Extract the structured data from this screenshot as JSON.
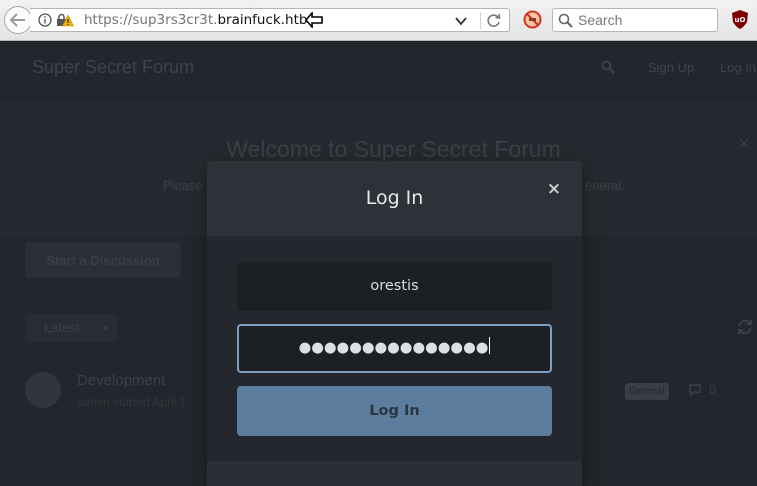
{
  "browser": {
    "url_prefix": "https://sup3rs3cr3t.",
    "url_host": "brainfuck.htb",
    "search_placeholder": "Search"
  },
  "forum": {
    "title": "Super Secret Forum",
    "nav_signup": "Sign Up",
    "nav_login": "Log In",
    "hero_title": "Welcome to Super Secret Forum",
    "hero_text_start": "Please",
    "hero_text_end": "eneral.",
    "start_discussion": "Start a Discussion",
    "sort_label": "Latest",
    "discussion": {
      "title": "Development",
      "meta": "admin started April 1",
      "tag": "General",
      "replies": "0"
    }
  },
  "modal": {
    "title": "Log In",
    "close": "×",
    "username_value": "orestis",
    "password_mask": "●●●●●●●●●●●●●●●",
    "submit_label": "Log In"
  },
  "colors": {
    "accent": "#5d7d9e",
    "focus_border": "#7d9fc5"
  }
}
